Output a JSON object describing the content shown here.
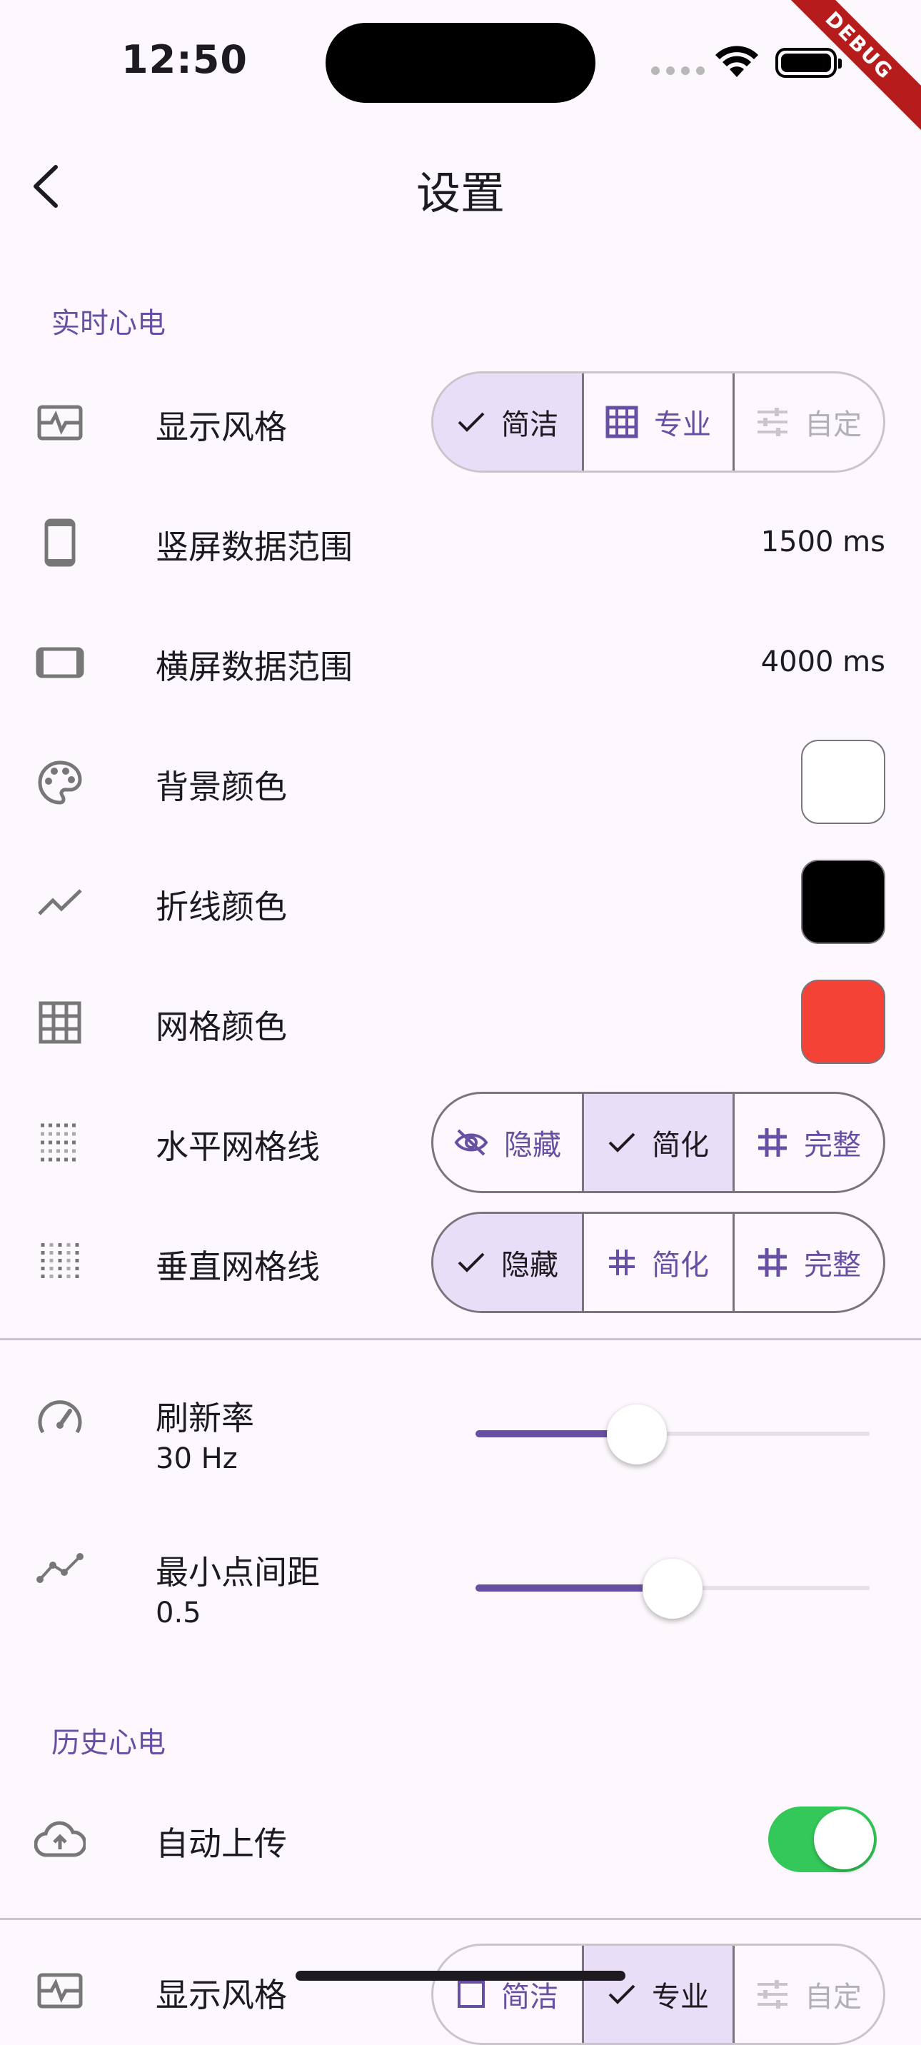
{
  "status_bar": {
    "time": "12:50",
    "debug_banner": "DEBUG"
  },
  "app_bar": {
    "title": "设置"
  },
  "realtime": {
    "section_title": "实时心电",
    "display_style": {
      "label": "显示风格",
      "options": [
        {
          "label": "简洁",
          "icon": "check-icon",
          "selected": true
        },
        {
          "label": "专业",
          "icon": "grid-icon",
          "selected": false
        },
        {
          "label": "自定",
          "icon": "tune-icon",
          "selected": false,
          "disabled": true
        }
      ]
    },
    "portrait_range": {
      "label": "竖屏数据范围",
      "value": "1500 ms"
    },
    "landscape_range": {
      "label": "横屏数据范围",
      "value": "4000 ms"
    },
    "background_color": {
      "label": "背景颜色",
      "color": "#ffffff"
    },
    "line_color": {
      "label": "折线颜色",
      "color": "#000000"
    },
    "grid_color": {
      "label": "网格颜色",
      "color": "#f44336"
    },
    "horizontal_grid": {
      "label": "水平网格线",
      "options": [
        {
          "label": "隐藏",
          "icon": "eye-off-icon",
          "selected": false
        },
        {
          "label": "简化",
          "icon": "check-icon",
          "selected": true
        },
        {
          "label": "完整",
          "icon": "hash-icon",
          "selected": false
        }
      ]
    },
    "vertical_grid": {
      "label": "垂直网格线",
      "options": [
        {
          "label": "隐藏",
          "icon": "check-icon",
          "selected": true
        },
        {
          "label": "简化",
          "icon": "hash-icon",
          "selected": false
        },
        {
          "label": "完整",
          "icon": "hash-icon",
          "selected": false
        }
      ]
    },
    "refresh_rate": {
      "label": "刷新率",
      "value": "30 Hz",
      "fraction": 0.41
    },
    "min_point_spacing": {
      "label": "最小点间距",
      "value": "0.5",
      "fraction": 0.5
    }
  },
  "history": {
    "section_title": "历史心电",
    "auto_upload": {
      "label": "自动上传",
      "enabled": true
    },
    "display_style": {
      "label": "显示风格",
      "options": [
        {
          "label": "简洁",
          "selected": false
        },
        {
          "label": "专业",
          "selected": true
        },
        {
          "label": "自定",
          "selected": false,
          "disabled": true
        }
      ]
    }
  }
}
